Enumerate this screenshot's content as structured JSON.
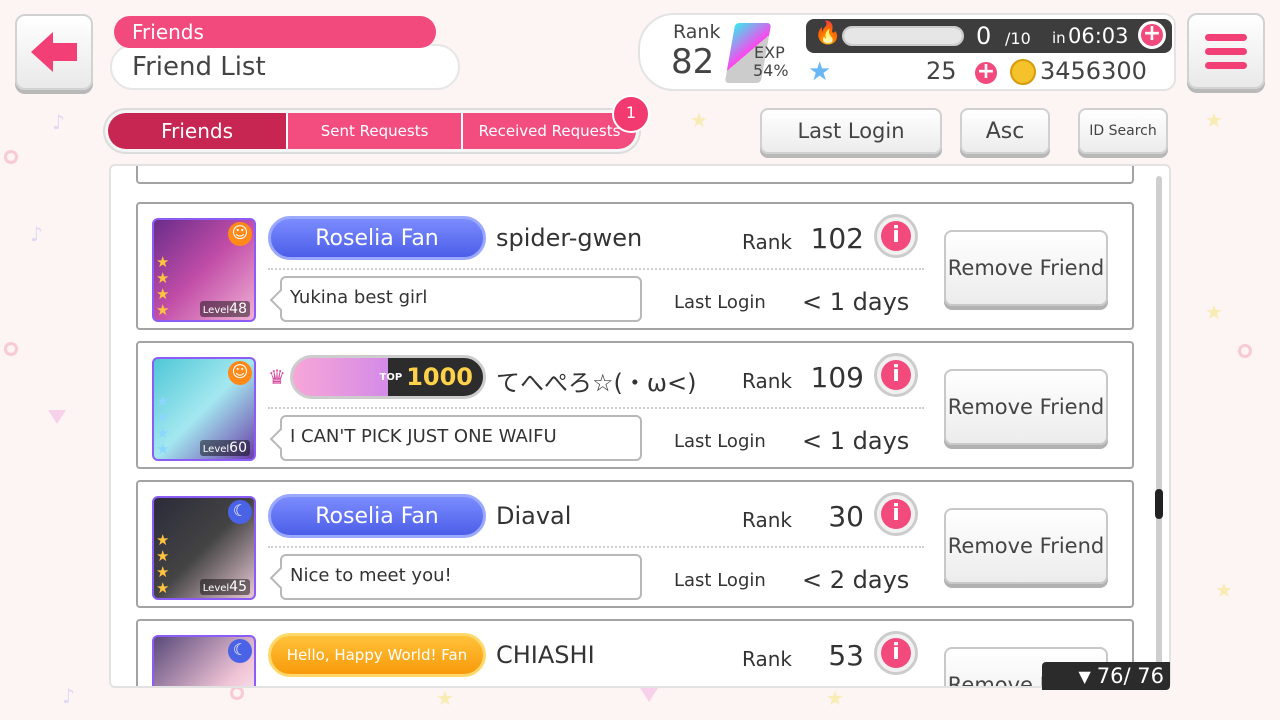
{
  "header": {
    "section_tag": "Friends",
    "title": "Friend List"
  },
  "status": {
    "rank_label": "Rank",
    "rank": "82",
    "exp_label": "EXP",
    "exp_percent": "54%",
    "stamina_value": "0",
    "stamina_max": "/10",
    "stamina_in": "in",
    "stamina_timer": "06:03",
    "stars": "25",
    "coins": "3456300"
  },
  "tabs": [
    {
      "label": "Friends"
    },
    {
      "label": "Sent Requests"
    },
    {
      "label": "Received Requests"
    }
  ],
  "received_badge": "1",
  "sort": {
    "mode": "Last Login",
    "order": "Asc",
    "id_search": "ID Search"
  },
  "labels": {
    "rank": "Rank",
    "last_login": "Last Login",
    "remove": "Remove Friend"
  },
  "friends": [
    {
      "name": "spider-gwen",
      "band": "Roselia Fan",
      "rank": "102",
      "comment": "Yukina best girl",
      "last_login": "< 1 days",
      "level_prefix": "Level",
      "level": "48"
    },
    {
      "name": "てへぺろ☆(・ω<)",
      "band": "1000",
      "band_top": "TOP",
      "rank": "109",
      "comment": "I CAN'T PICK JUST ONE WAIFU",
      "last_login": "< 1 days",
      "level_prefix": "Level",
      "level": "60"
    },
    {
      "name": "Diaval",
      "band": "Roselia Fan",
      "rank": "30",
      "comment": "Nice to meet you!",
      "last_login": "< 2 days",
      "level_prefix": "Level",
      "level": "45"
    },
    {
      "name": "CHIASHI",
      "band": "Hello, Happy World! Fan",
      "rank": "53",
      "comment": "",
      "last_login": "",
      "level_prefix": "",
      "level": ""
    }
  ],
  "friend_count": "76/ 76",
  "colors": {
    "accent": "#f24a7d",
    "tab_active": "#c82652",
    "roselia": "#5566ee",
    "hhw": "#f8a51a"
  }
}
